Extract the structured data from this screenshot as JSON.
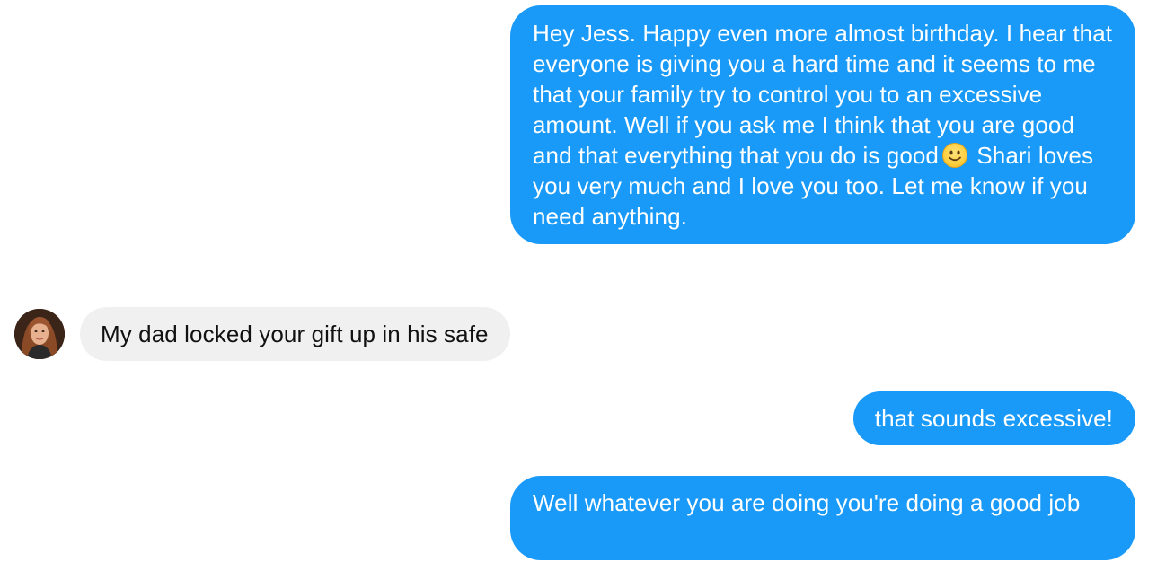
{
  "messages": [
    {
      "direction": "sent",
      "text_before_emoji": "Hey Jess. Happy even more almost birthday. I hear that everyone is giving you a hard time and it seems to me that your family try to control you to an excessive amount. Well if you ask me I think that you are good and that everything that you do is good",
      "emoji": "slightly-smiling-face",
      "text_after_emoji": "Shari loves you very much and I love you too. Let me know if you need anything."
    },
    {
      "direction": "received",
      "text": "My dad locked your gift up in his safe",
      "avatar": "contact-avatar"
    },
    {
      "direction": "sent",
      "text": "that sounds excessive!"
    },
    {
      "direction": "sent",
      "text": "Well whatever you are doing you're doing a good job"
    }
  ],
  "colors": {
    "sent_bubble": "#1a9af8",
    "received_bubble": "#f0f0f0",
    "sent_text": "#ffffff",
    "received_text": "#111111"
  }
}
